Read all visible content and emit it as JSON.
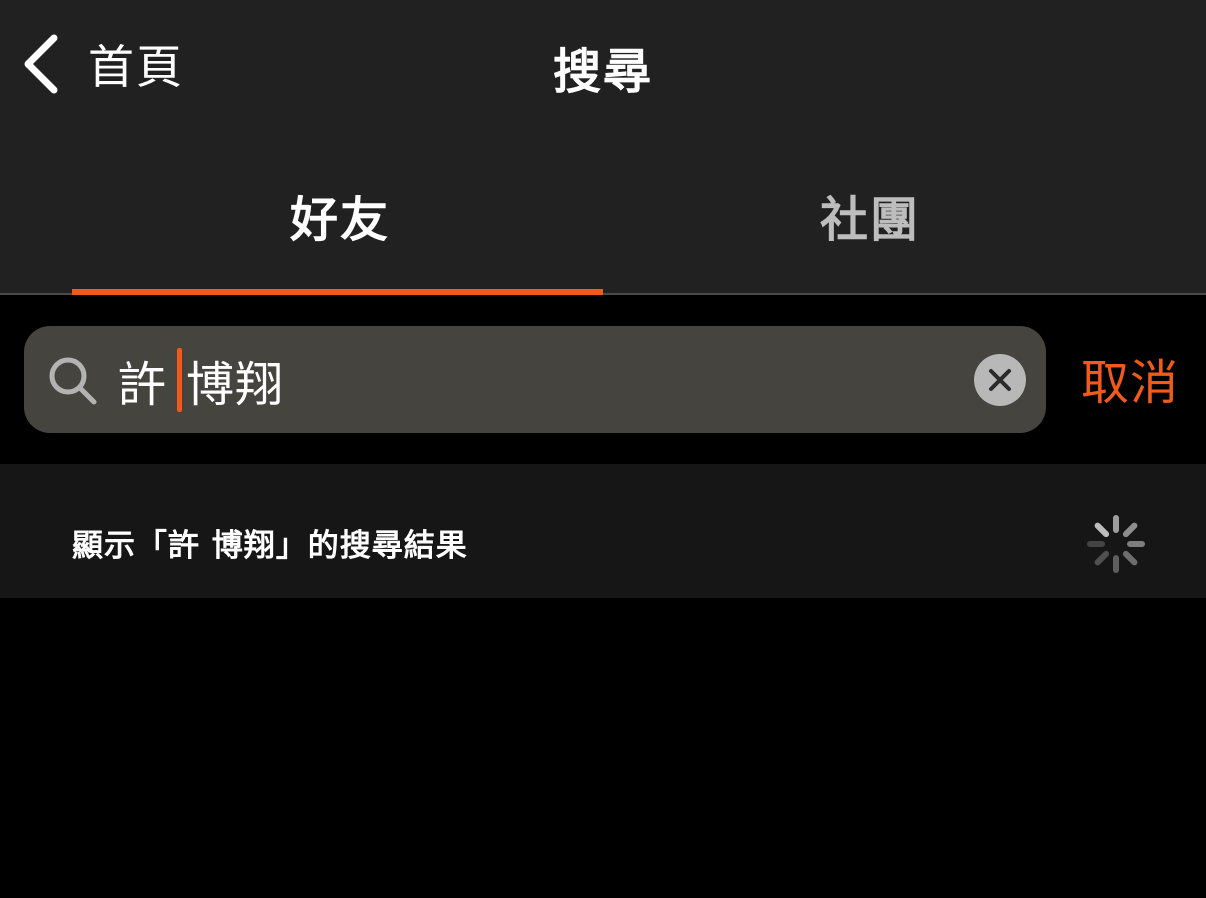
{
  "nav": {
    "back_label": "首頁",
    "title": "搜尋"
  },
  "tabs": [
    {
      "label": "好友",
      "active": true
    },
    {
      "label": "社團",
      "active": false
    }
  ],
  "search": {
    "value_before_caret": "許",
    "value_after_caret": "博翔",
    "cancel_label": "取消"
  },
  "result": {
    "text": "顯示「許 博翔」的搜尋結果"
  },
  "icons": {
    "back": "chevron-left-icon",
    "search": "magnifier-icon",
    "clear": "close-circle-icon",
    "spinner": "loading-spinner-icon"
  },
  "colors": {
    "accent": "#f05a1a",
    "header_bg": "#212121",
    "search_bg": "#46443f",
    "row_bg": "#161616",
    "page_bg": "#000000"
  }
}
